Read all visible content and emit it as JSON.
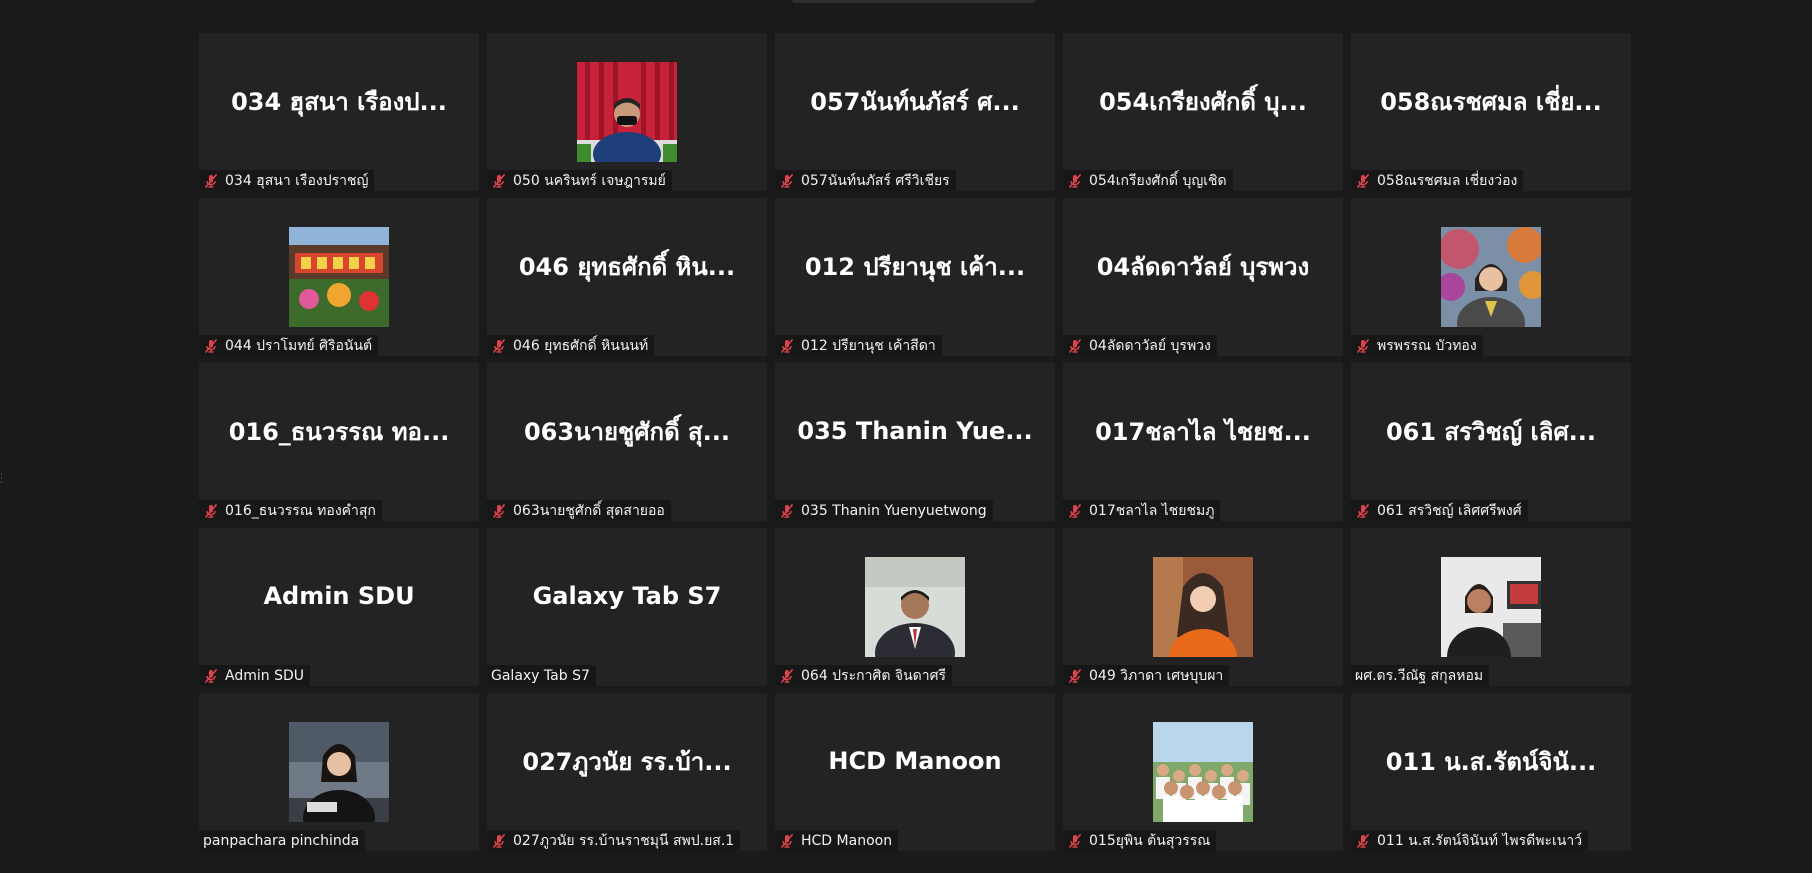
{
  "tiles": [
    {
      "center_name": "034 ฮุสนา เรืองป...",
      "label": "034 ฮุสนา เรืองปราชญ์",
      "muted": true,
      "video": null
    },
    {
      "center_name": "",
      "label": "050 นครินทร์ เจษฎารมย์",
      "muted": true,
      "video": "man-mask-red-curtain"
    },
    {
      "center_name": "057นันท์นภัสร์ ศ...",
      "label": "057นันท์นภัสร์ ศรีวิเชียร",
      "muted": true,
      "video": null
    },
    {
      "center_name": "054เกรียงศักดิ์ บุ...",
      "label": "054เกรียงศักดิ์ บุญเชิด",
      "muted": true,
      "video": null
    },
    {
      "center_name": "058ณรชศมล เชี่ย...",
      "label": "058ณรชศมล เชี่ยงว่อง",
      "muted": true,
      "video": null
    },
    {
      "center_name": "",
      "label": "044 ปราโมทย์ ศิริอนันต์",
      "muted": true,
      "video": "colorful-sign"
    },
    {
      "center_name": "046 ยุทธศักดิ์ หิน...",
      "label": "046 ยุทธศักดิ์ หินนนท์",
      "muted": true,
      "video": null
    },
    {
      "center_name": "012 ปรียานุช เค้า...",
      "label": "012 ปรียานุช เค้าสีดา",
      "muted": true,
      "video": null
    },
    {
      "center_name": "04ลัดดาวัลย์ บุรพวง",
      "label": "04ลัดดาวัลย์ บุรพวง",
      "muted": true,
      "video": null
    },
    {
      "center_name": "",
      "label": "พรพรรณ บัวทอง",
      "muted": true,
      "video": "woman-yellow-blazer"
    },
    {
      "center_name": "016_ธนวรรณ ทอ...",
      "label": "016_ธนวรรณ ทองคำสุก",
      "muted": true,
      "video": null
    },
    {
      "center_name": "063นายชูศักดิ์  สุ...",
      "label": "063นายชูศักดิ์  สุดสายออ",
      "muted": true,
      "video": null
    },
    {
      "center_name": "035 Thanin Yue...",
      "label": "035 Thanin Yuenyuetwong",
      "muted": true,
      "video": null
    },
    {
      "center_name": "017ชลาไล ไชยช...",
      "label": "017ชลาไล ไชยชมภู",
      "muted": true,
      "video": null
    },
    {
      "center_name": "061  สรวิชญ์ เลิศ...",
      "label": "061  สรวิชญ์ เลิศศรีพงศ์",
      "muted": true,
      "video": null
    },
    {
      "center_name": "Admin SDU",
      "label": "Admin SDU",
      "muted": true,
      "video": null
    },
    {
      "center_name": "Galaxy Tab S7",
      "label": "Galaxy Tab S7",
      "muted": false,
      "video": null
    },
    {
      "center_name": "",
      "label": "064 ประกาศิต จินดาศรี",
      "muted": true,
      "video": "man-suit-office"
    },
    {
      "center_name": "",
      "label": "049 วิภาดา เศษบุบผา",
      "muted": true,
      "video": "woman-orange-dress"
    },
    {
      "center_name": "",
      "label": "ผศ.ดร.วีณัฐ สกุลหอม",
      "muted": false,
      "video": "woman-desk-monitor"
    },
    {
      "center_name": "",
      "label": "panpachara pinchinda",
      "muted": false,
      "video": "woman-black-blazer"
    },
    {
      "center_name": "027ภูวนัย รร.บ้า...",
      "label": "027ภูวนัย รร.บ้านราชมุนี สพป.ยส.1",
      "muted": true,
      "video": null
    },
    {
      "center_name": "HCD Manoon",
      "label": "HCD Manoon",
      "muted": true,
      "video": null
    },
    {
      "center_name": "",
      "label": "015ยุพิน ต้นสุวรรณ",
      "muted": true,
      "video": "group-students"
    },
    {
      "center_name": "011 น.ส.รัตน์จินั...",
      "label": "011 น.ส.รัตน์จินันท์ ไพรดีพะเนาว์",
      "muted": true,
      "video": null
    }
  ],
  "colors": {
    "background": "#1a1a1a",
    "tile": "#232323",
    "label_bg": "#171717",
    "muted_mic": "#e0424b"
  },
  "icons": {
    "muted": "mic-off-icon"
  }
}
